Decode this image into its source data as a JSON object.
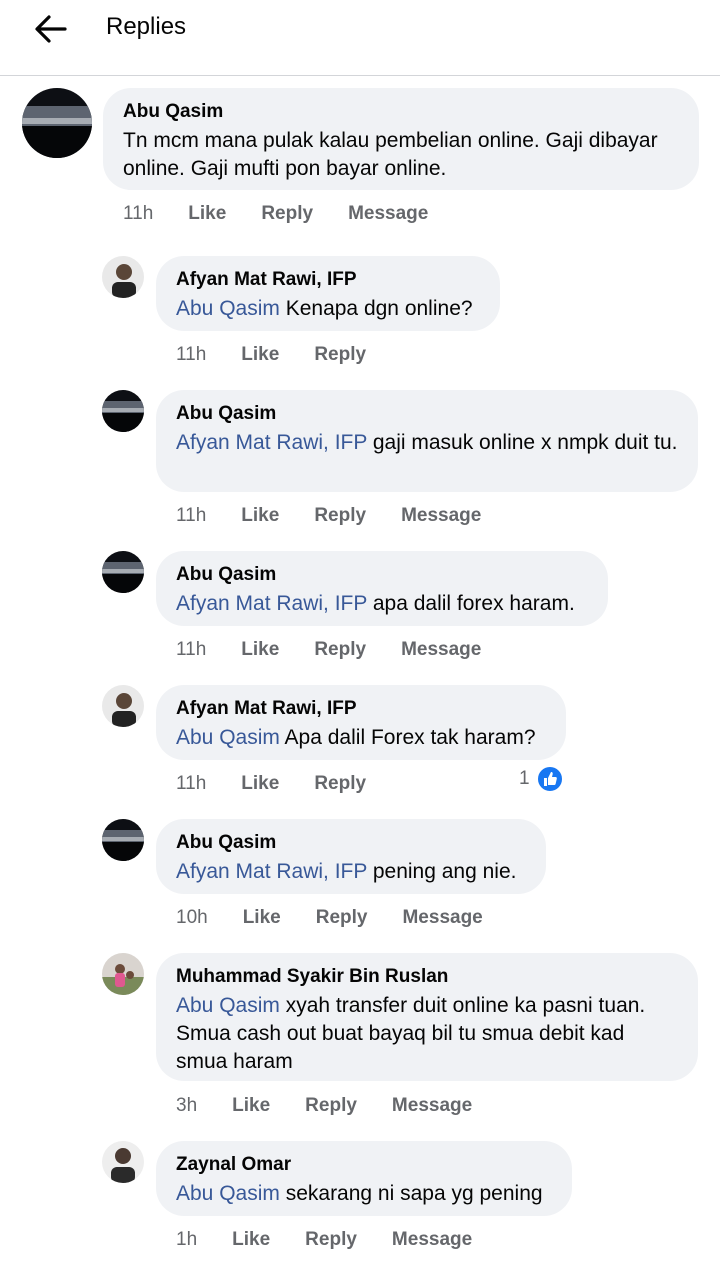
{
  "header": {
    "title": "Replies",
    "back_icon": "arrow-left-icon"
  },
  "comments": [
    {
      "author": "Abu Qasim",
      "mention": "",
      "text": "Tn mcm mana pulak kalau pembelian online. Gaji dibayar online. Gaji mufti pon bayar online.",
      "time": "11h",
      "like": "Like",
      "reply": "Reply",
      "message": "Message"
    },
    {
      "author": "Afyan Mat Rawi, IFP",
      "mention": "Abu Qasim",
      "text": " Kenapa dgn online?",
      "time": "11h",
      "like": "Like",
      "reply": "Reply",
      "message": ""
    },
    {
      "author": "Abu Qasim",
      "mention": "Afyan Mat Rawi, IFP",
      "text": " gaji masuk online x nmpk duit tu.",
      "time": "11h",
      "like": "Like",
      "reply": "Reply",
      "message": "Message"
    },
    {
      "author": "Abu Qasim",
      "mention": "Afyan Mat Rawi, IFP",
      "text": " apa dalil forex haram.",
      "time": "11h",
      "like": "Like",
      "reply": "Reply",
      "message": "Message"
    },
    {
      "author": "Afyan Mat Rawi, IFP",
      "mention": "Abu Qasim",
      "text": " Apa dalil Forex tak haram?",
      "time": "11h",
      "like": "Like",
      "reply": "Reply",
      "message": "",
      "reaction_count": "1"
    },
    {
      "author": "Abu Qasim",
      "mention": "Afyan Mat Rawi, IFP",
      "text": " pening ang nie.",
      "time": "10h",
      "like": "Like",
      "reply": "Reply",
      "message": "Message"
    },
    {
      "author": "Muhammad Syakir Bin Ruslan",
      "mention": "Abu Qasim",
      "text": " xyah transfer duit online ka pasni tuan. Smua cash out buat bayaq bil tu smua debit kad smua haram",
      "time": "3h",
      "like": "Like",
      "reply": "Reply",
      "message": "Message"
    },
    {
      "author": "Zaynal Omar",
      "mention": "Abu Qasim",
      "text": " sekarang ni sapa yg pening",
      "time": "1h",
      "like": "Like",
      "reply": "Reply",
      "message": "Message"
    }
  ],
  "colors": {
    "mention": "#385898",
    "bubble": "#f0f2f5",
    "meta": "#65676b",
    "like_blue": "#1877f2"
  }
}
